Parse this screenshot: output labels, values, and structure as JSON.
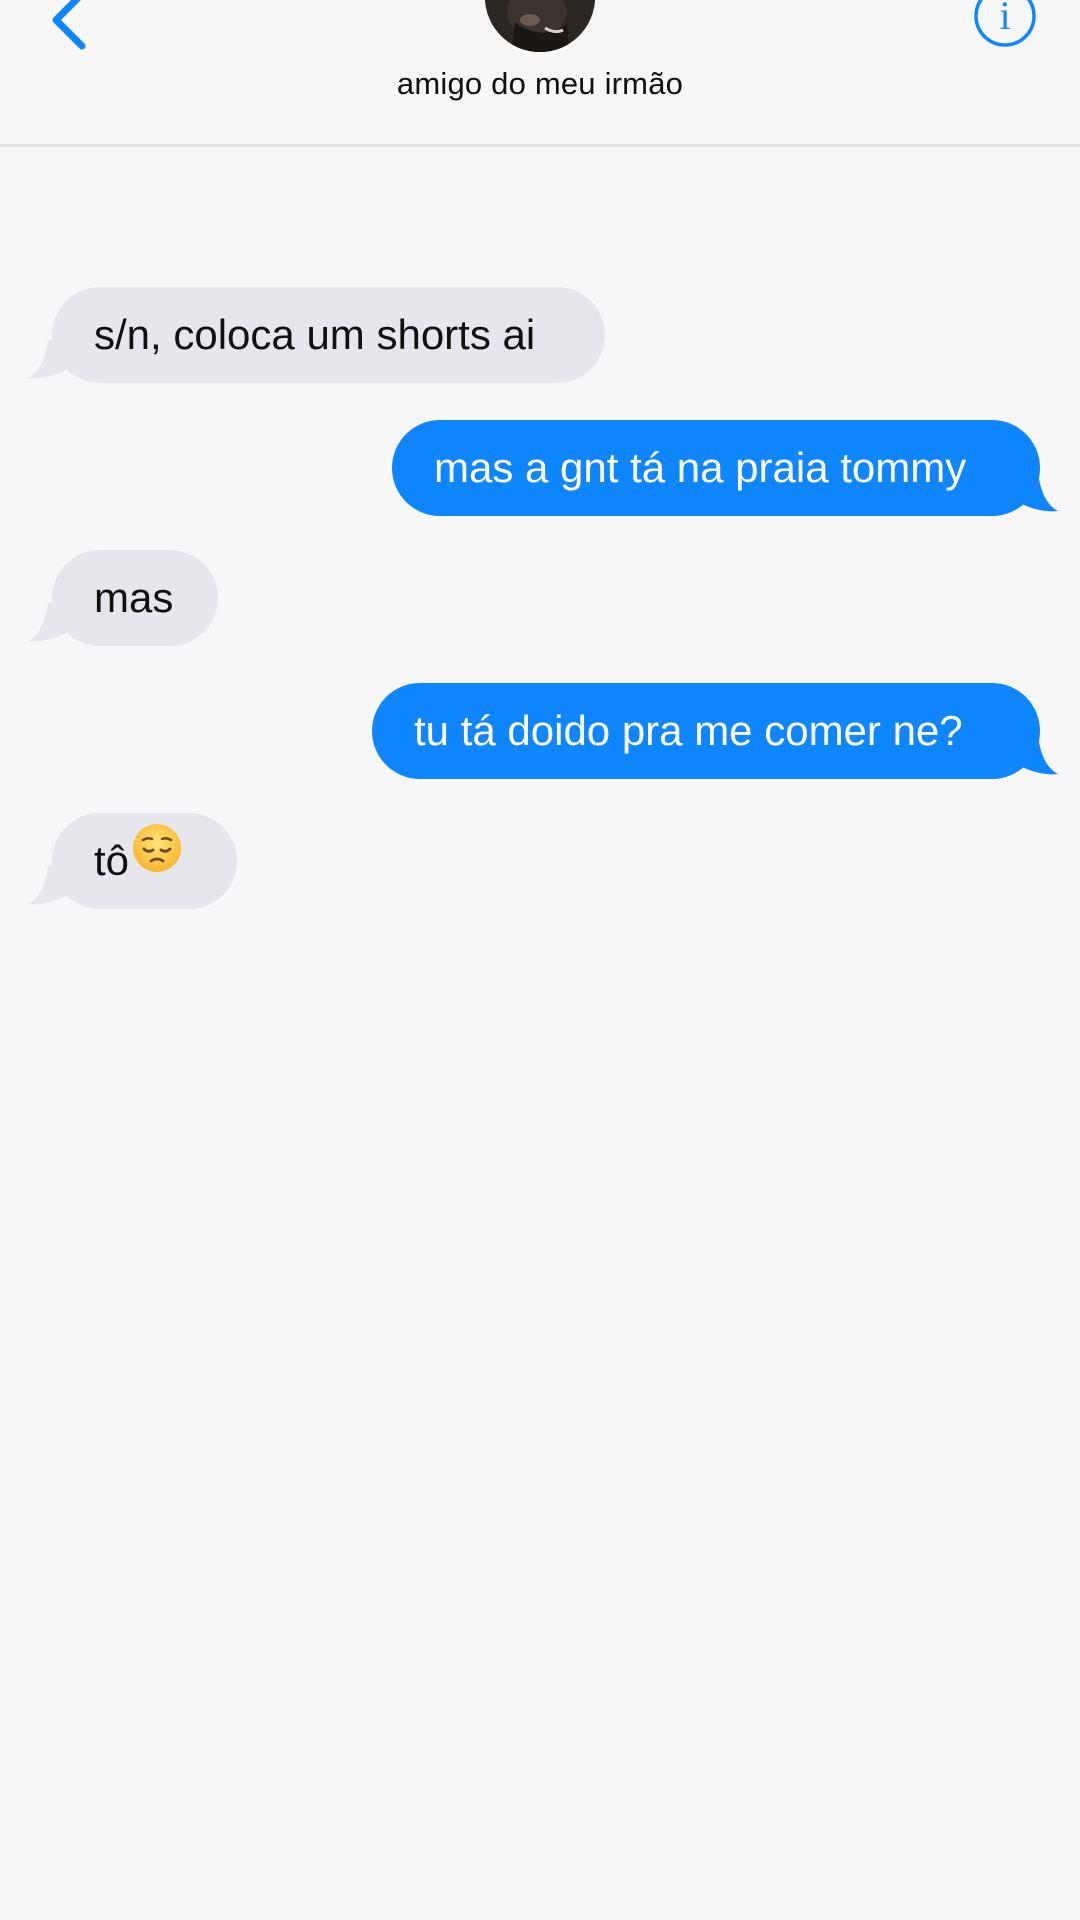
{
  "header": {
    "contact_name": "amigo do meu irmão",
    "back_icon": "chevron-left-icon",
    "info_icon": "info-icon",
    "accent_color": "#0f86fe"
  },
  "messages": [
    {
      "direction": "received",
      "text": "s/n, coloca um shorts ai"
    },
    {
      "direction": "sent",
      "text": "mas a gnt tá na praia tommy"
    },
    {
      "direction": "received",
      "text": "mas"
    },
    {
      "direction": "sent",
      "text": "tu tá doido pra me comer ne?"
    },
    {
      "direction": "received",
      "text": "tô",
      "emoji": "😔",
      "emoji_icon": "pensive-face-icon"
    }
  ],
  "colors": {
    "background": "#f7f7f8",
    "received_bubble": "#e7e6ec",
    "sent_bubble": "#0f86fe",
    "sent_text": "#ffffff",
    "received_text": "#111111"
  }
}
